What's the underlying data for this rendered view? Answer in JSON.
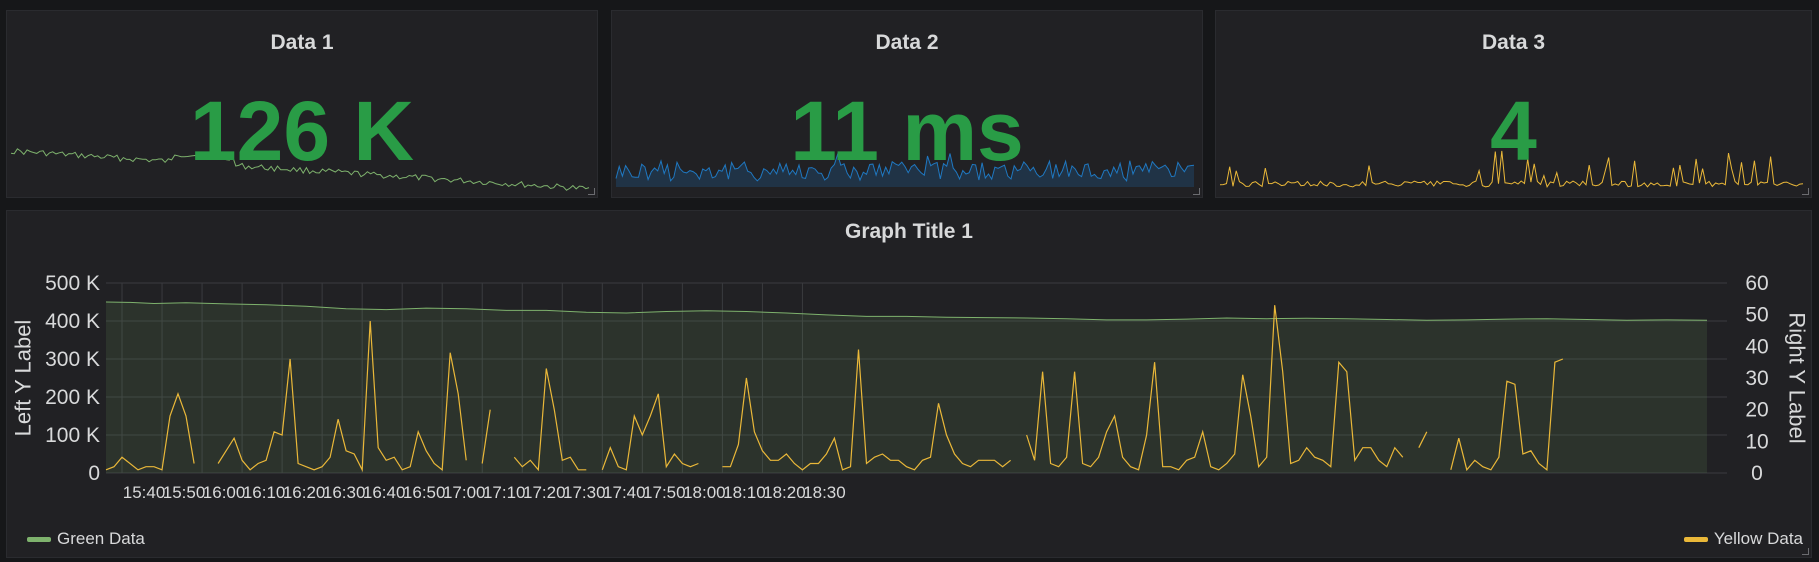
{
  "stats": [
    {
      "title": "Data 1",
      "value": "126 K",
      "spark_color": "#7eb26d",
      "spark_fill": false
    },
    {
      "title": "Data 2",
      "value": "11 ms",
      "spark_color": "#1f78c1",
      "spark_fill": true
    },
    {
      "title": "Data 3",
      "value": "4",
      "spark_color": "#eab839",
      "spark_fill": false
    }
  ],
  "graph": {
    "title": "Graph Title 1",
    "left_ylabel": "Left Y Label",
    "right_ylabel": "Right Y Label",
    "legend": [
      {
        "name": "Green Data",
        "color": "#7eb26d"
      },
      {
        "name": "Yellow Data",
        "color": "#eab839"
      }
    ]
  },
  "chart_data": {
    "type": "line",
    "title": "Graph Title 1",
    "xlabel": "",
    "x_ticks": [
      "15:40",
      "15:50",
      "16:00",
      "16:10",
      "16:20",
      "16:30",
      "16:40",
      "16:50",
      "17:00",
      "17:10",
      "17:20",
      "17:30",
      "17:40",
      "17:50",
      "18:00",
      "18:10",
      "18:20",
      "18:30"
    ],
    "y_left": {
      "label": "Left Y Label",
      "ticks": [
        "0",
        "100 K",
        "200 K",
        "300 K",
        "400 K",
        "500 K"
      ],
      "ylim": [
        0,
        500000
      ]
    },
    "y_right": {
      "label": "Right Y Label",
      "ticks": [
        "0",
        "10",
        "20",
        "30",
        "40",
        "50",
        "60"
      ],
      "ylim": [
        0,
        60
      ]
    },
    "grid": true,
    "series": [
      {
        "name": "Green Data",
        "axis": "left",
        "color": "#7eb26d",
        "x_minutes": [
          0,
          6,
          12,
          20,
          30,
          40,
          50,
          60,
          70,
          80,
          90,
          100,
          110,
          120,
          130,
          140,
          150,
          160,
          170,
          180,
          190,
          200,
          210,
          220,
          230,
          240,
          250,
          260,
          270,
          280,
          290,
          300,
          310,
          320,
          330,
          340,
          350,
          360,
          370,
          380,
          390,
          400
        ],
        "values": [
          450000,
          449000,
          446000,
          448000,
          445000,
          443000,
          439000,
          432000,
          430000,
          434000,
          432000,
          428000,
          428000,
          423000,
          421000,
          425000,
          427000,
          425000,
          421000,
          416000,
          412000,
          412000,
          410000,
          409000,
          408000,
          406000,
          403000,
          403000,
          405000,
          408000,
          406000,
          407000,
          406000,
          404000,
          402000,
          403000,
          405000,
          406000,
          404000,
          402000,
          403000,
          402000
        ]
      },
      {
        "name": "Yellow Data",
        "axis": "right",
        "color": "#eab839",
        "x_minutes": [
          0,
          2,
          4,
          8,
          10,
          12,
          14,
          16,
          18,
          20,
          22,
          24,
          28,
          30,
          32,
          34,
          36,
          38,
          40,
          42,
          44,
          46,
          48,
          50,
          52,
          54,
          56,
          58,
          60,
          62,
          64,
          66,
          68,
          70,
          72,
          74,
          76,
          78,
          80,
          82,
          84,
          86,
          88,
          90,
          92,
          94,
          96,
          100,
          102,
          104,
          106,
          108,
          110,
          112,
          114,
          116,
          118,
          120,
          122,
          124,
          126,
          128,
          130,
          132,
          134,
          136,
          138,
          140,
          142,
          144,
          146,
          148,
          150,
          152,
          154,
          156,
          158,
          160,
          162,
          164,
          166,
          168,
          170,
          172,
          174,
          176,
          178,
          180,
          182,
          184,
          186,
          188,
          190,
          192,
          194,
          196,
          198,
          200,
          202,
          204,
          206,
          208,
          210,
          212,
          214,
          216,
          218,
          220,
          222,
          224,
          226,
          228,
          230,
          232,
          234,
          236,
          238,
          240,
          242,
          244,
          246,
          248,
          250,
          252,
          254,
          256,
          258,
          260,
          262,
          264,
          266,
          268,
          270,
          272,
          274,
          276,
          278,
          280,
          282,
          284,
          286,
          288,
          290,
          292,
          294,
          296,
          298,
          300,
          302,
          304,
          306,
          308,
          310,
          312,
          314,
          316,
          318,
          320,
          322,
          324,
          326,
          328,
          330,
          332,
          334,
          336,
          338,
          340,
          342,
          344,
          346,
          348,
          350,
          352,
          354,
          356,
          358,
          360,
          362,
          364,
          366,
          368,
          370,
          372,
          374,
          376,
          378,
          380,
          382,
          384,
          386,
          388,
          390,
          392,
          394,
          396,
          398,
          400
        ],
        "values": [
          1,
          2,
          5,
          1,
          2,
          2,
          1,
          18,
          25,
          18,
          3,
          null,
          3,
          7,
          11,
          4,
          1,
          3,
          4,
          13,
          12,
          36,
          3,
          2,
          1,
          2,
          5,
          17,
          7,
          6,
          1,
          48,
          8,
          4,
          5,
          1,
          2,
          13,
          7,
          3,
          1,
          38,
          25,
          4,
          null,
          3,
          20,
          null,
          5,
          2,
          4,
          1,
          33,
          20,
          4,
          5,
          1,
          1,
          null,
          1,
          8,
          2,
          1,
          18,
          12,
          18,
          25,
          2,
          6,
          3,
          2,
          3,
          null,
          null,
          2,
          2,
          9,
          30,
          13,
          7,
          4,
          4,
          6,
          3,
          1,
          3,
          3,
          6,
          11,
          1,
          2,
          39,
          3,
          5,
          6,
          4,
          4,
          2,
          1,
          4,
          5,
          22,
          12,
          6,
          3,
          2,
          4,
          4,
          4,
          2,
          4,
          null,
          12,
          4,
          32,
          3,
          2,
          5,
          32,
          3,
          2,
          5,
          13,
          18,
          5,
          2,
          1,
          12,
          35,
          2,
          2,
          1,
          4,
          5,
          13,
          2,
          1,
          3,
          6,
          31,
          18,
          2,
          5,
          53,
          32,
          3,
          4,
          8,
          5,
          4,
          2,
          35,
          32,
          4,
          8,
          8,
          4,
          2,
          8,
          5,
          null,
          8,
          13,
          null,
          null,
          1,
          11,
          1,
          4,
          2,
          1,
          5,
          29,
          28,
          6,
          7,
          3,
          1,
          35,
          36
        ]
      }
    ]
  }
}
